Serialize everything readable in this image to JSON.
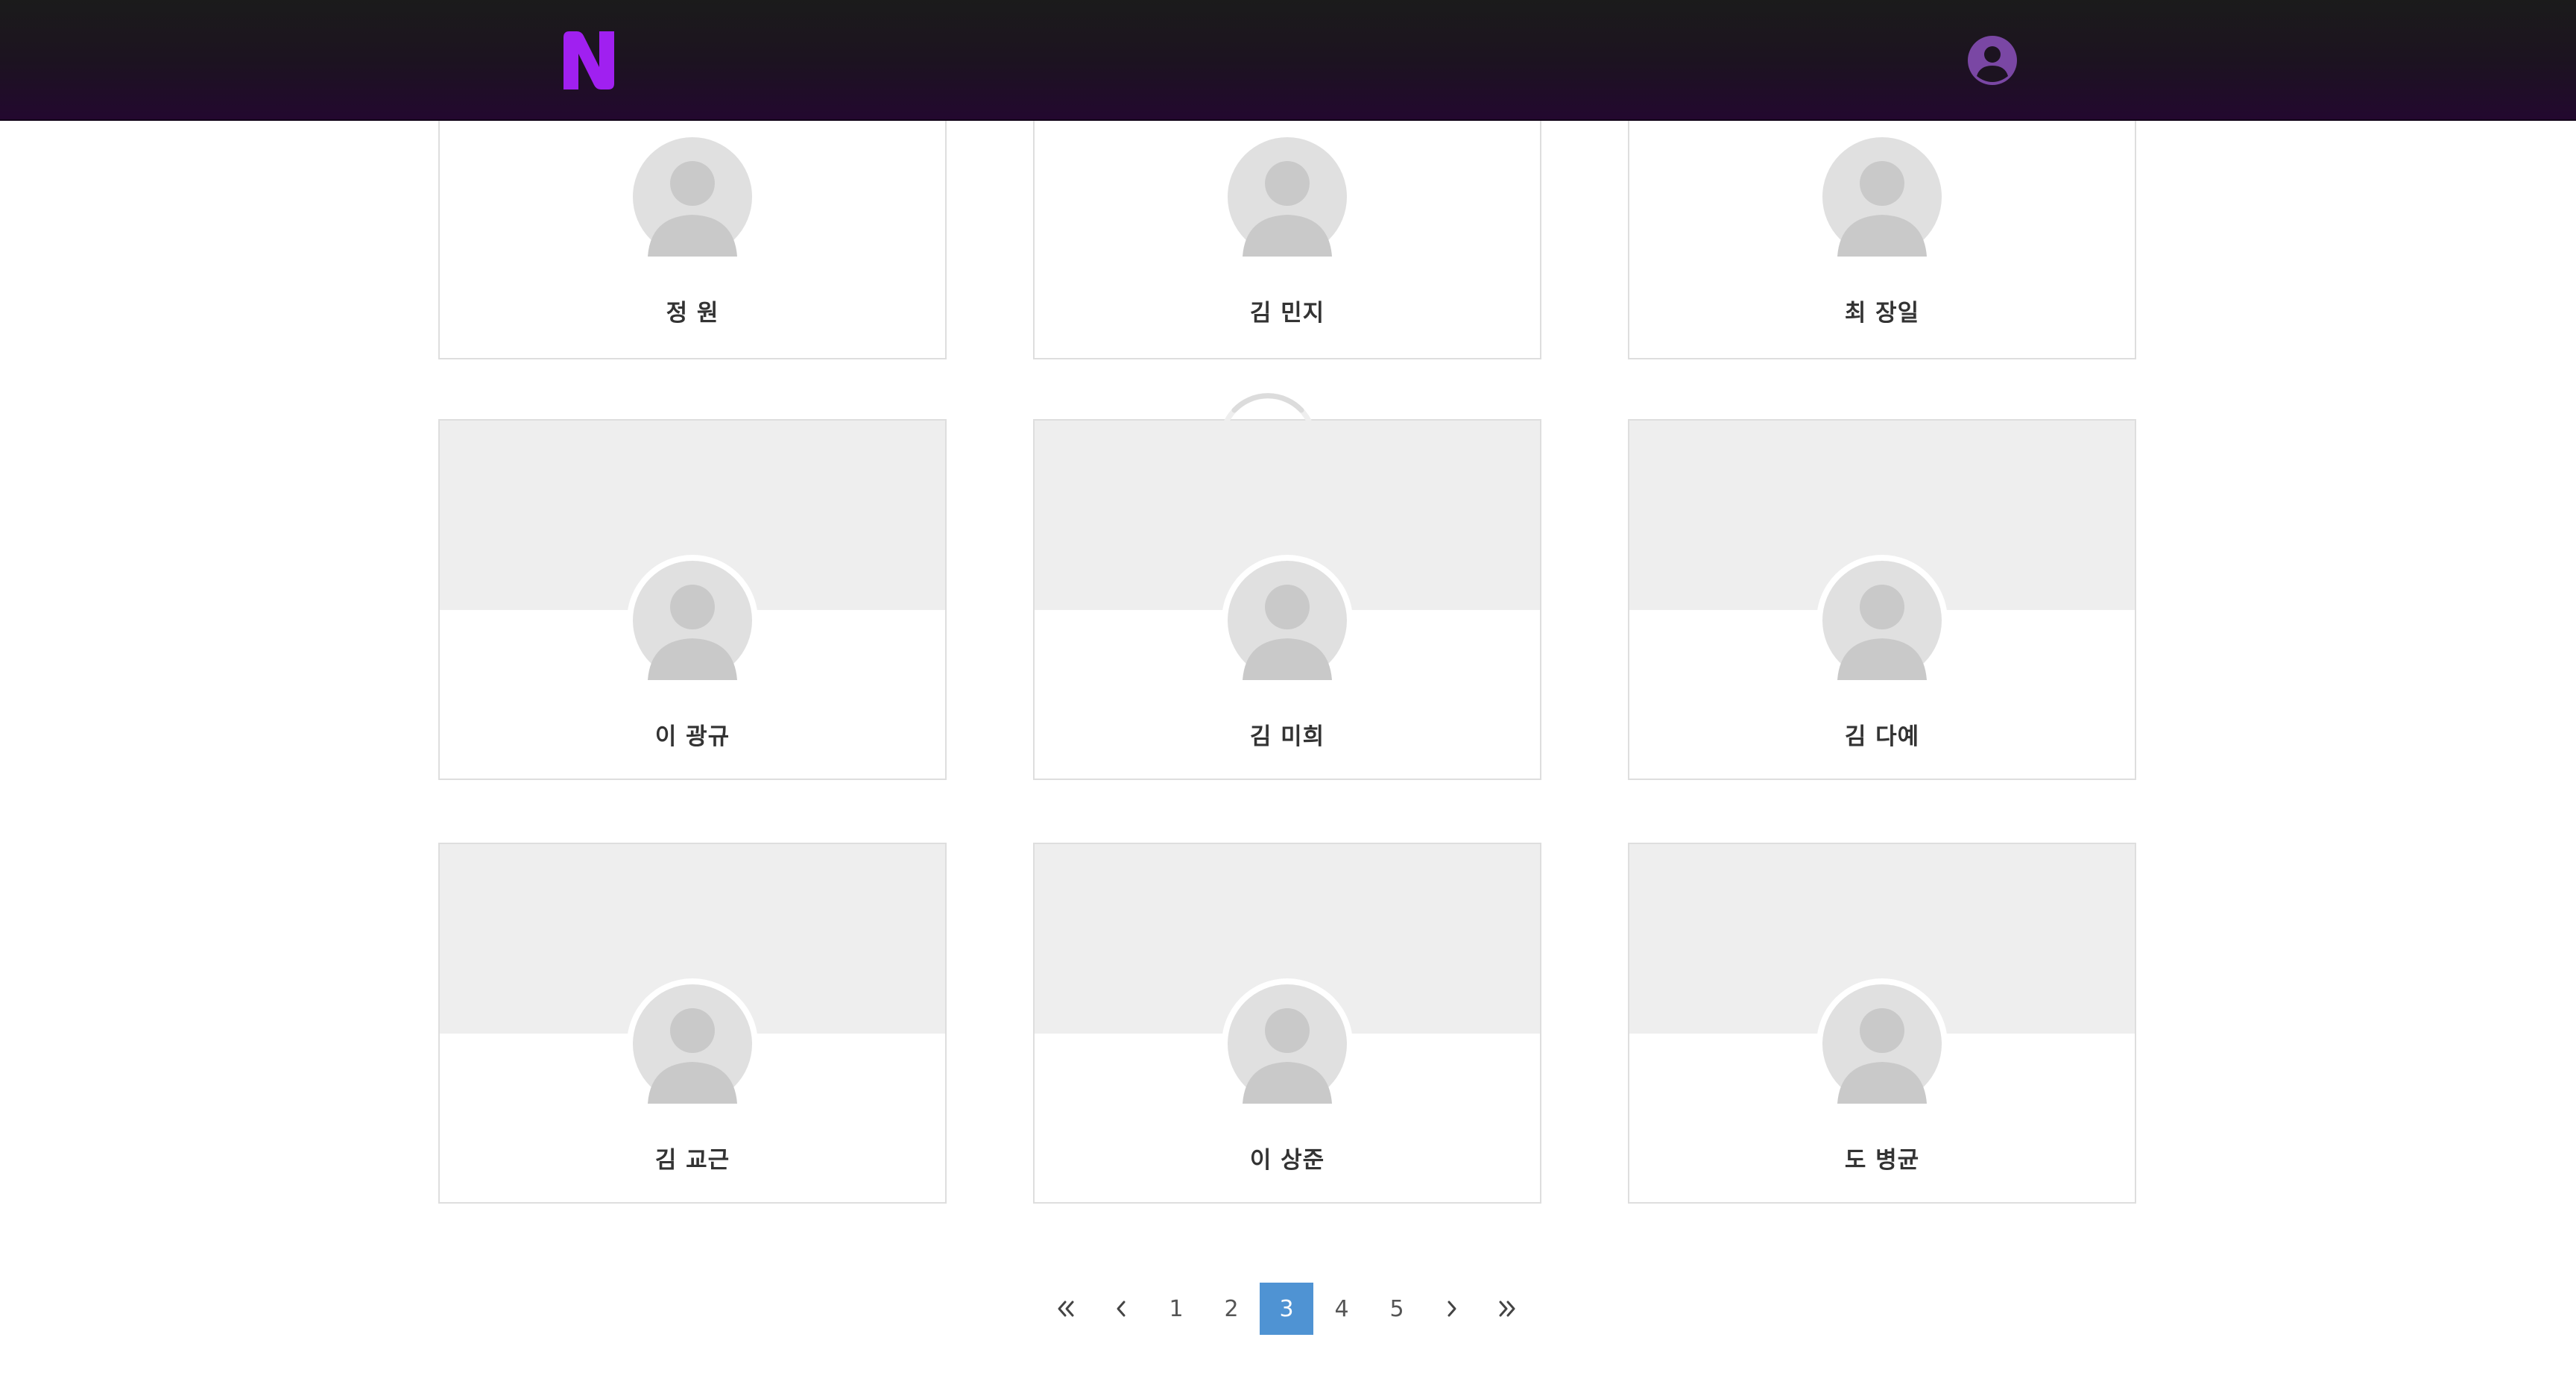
{
  "header": {
    "logo_letter": "N",
    "logo_color": "#a020f0",
    "profile_icon_color": "#7a47a4"
  },
  "cards": [
    {
      "name": "정 원"
    },
    {
      "name": "김 민지"
    },
    {
      "name": "최 장일"
    },
    {
      "name": "이 광규"
    },
    {
      "name": "김 미희"
    },
    {
      "name": "김 다예"
    },
    {
      "name": "김 교근"
    },
    {
      "name": "이 상준"
    },
    {
      "name": "도 병균"
    }
  ],
  "pagination": {
    "first_icon": "double-chevron-left-icon",
    "prev_icon": "chevron-left-icon",
    "pages": [
      "1",
      "2",
      "3",
      "4",
      "5"
    ],
    "current_page": "3",
    "next_icon": "chevron-right-icon",
    "last_icon": "double-chevron-right-icon",
    "active_color": "#4f93d3"
  },
  "loading_spinner": {
    "icon": "loading-spinner-icon"
  }
}
